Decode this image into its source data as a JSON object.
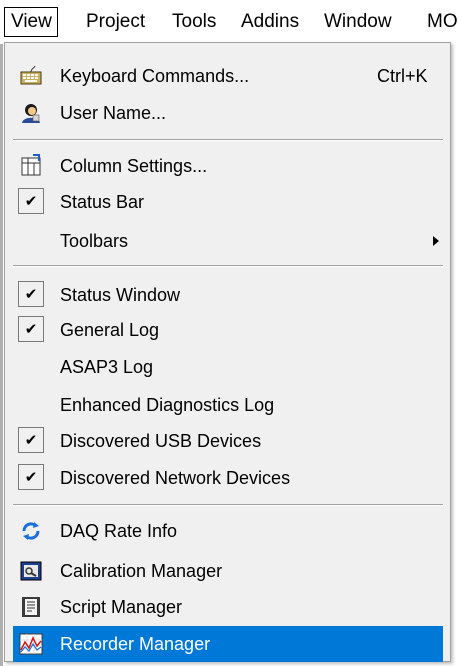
{
  "menubar": {
    "items": [
      "View",
      "Project",
      "Tools",
      "Addins",
      "Window",
      "MO"
    ]
  },
  "menu": {
    "keyboard_commands": {
      "label": "Keyboard Commands...",
      "shortcut": "Ctrl+K"
    },
    "user_name": {
      "label": "User Name..."
    },
    "column_settings": {
      "label": "Column Settings..."
    },
    "status_bar": {
      "label": "Status Bar",
      "checked": true
    },
    "toolbars": {
      "label": "Toolbars",
      "submenu": true
    },
    "status_window": {
      "label": "Status Window",
      "checked": true
    },
    "general_log": {
      "label": "General Log",
      "checked": true
    },
    "asap3_log": {
      "label": "ASAP3 Log",
      "checked": false
    },
    "enhanced_diag_log": {
      "label": "Enhanced Diagnostics Log",
      "checked": false
    },
    "discovered_usb": {
      "label": "Discovered USB Devices",
      "checked": true
    },
    "discovered_network": {
      "label": "Discovered Network Devices",
      "checked": true
    },
    "daq_rate_info": {
      "label": "DAQ Rate Info"
    },
    "calibration_manager": {
      "label": "Calibration Manager"
    },
    "script_manager": {
      "label": "Script Manager"
    },
    "recorder_manager": {
      "label": "Recorder Manager",
      "highlighted": true
    }
  },
  "colors": {
    "highlight": "#0078d7",
    "menu_bg": "#f0f0f0"
  },
  "icons": {
    "keyboard_commands": "keyboard-icon",
    "user_name": "user-icon",
    "column_settings": "columns-icon",
    "daq_rate_info": "refresh-icon",
    "calibration_manager": "calibration-icon",
    "script_manager": "script-icon",
    "recorder_manager": "recorder-chart-icon"
  }
}
